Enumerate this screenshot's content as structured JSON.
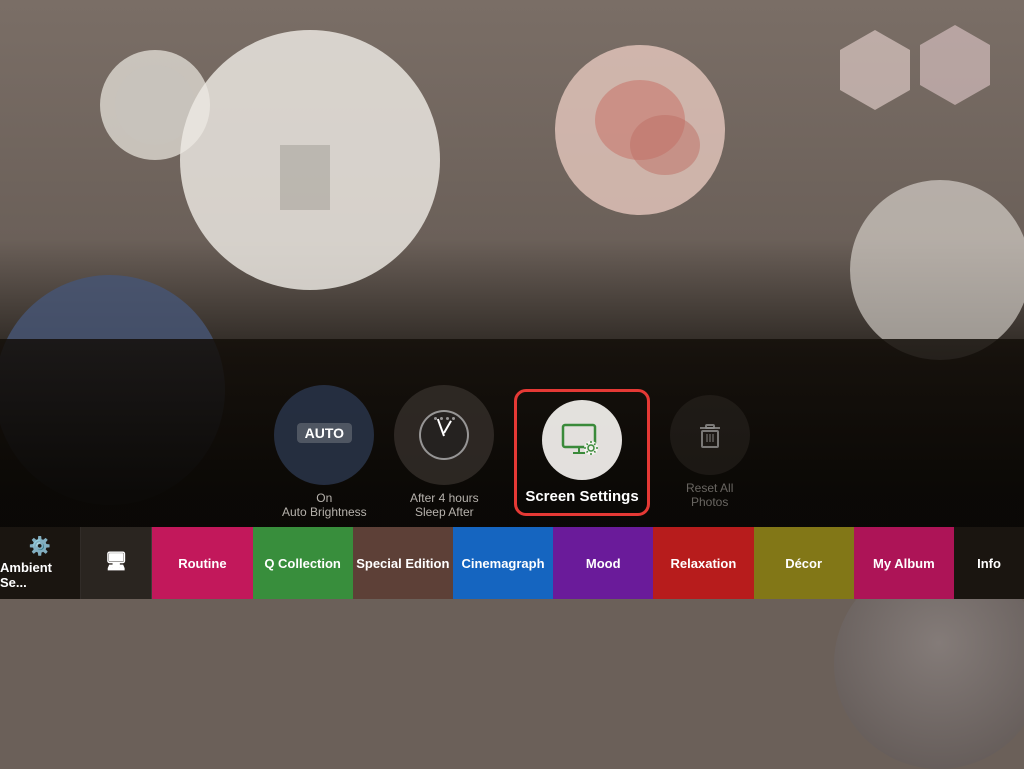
{
  "background": {
    "color": "#7a6e66"
  },
  "controls": {
    "auto_brightness": {
      "auto_label": "AUTO",
      "status": "On",
      "sub": "Auto Brightness"
    },
    "sleep": {
      "status": "After 4 hours",
      "sub": "Sleep After"
    },
    "screen_settings": {
      "label": "Screen Settings"
    },
    "reset": {
      "label": "Reset All Photos"
    }
  },
  "tabs": [
    {
      "id": "ambient",
      "label": "Ambient Se...",
      "icon": "⚙",
      "color": "#1a1510"
    },
    {
      "id": "screen",
      "label": "",
      "icon": "🖥",
      "color": "#2a2520"
    },
    {
      "id": "routine",
      "label": "Routine",
      "color": "#c2185b"
    },
    {
      "id": "collection",
      "label": "Q Collection",
      "color": "#388e3c"
    },
    {
      "id": "special",
      "label": "Special Edition",
      "color": "#5d4037"
    },
    {
      "id": "cinemagraph",
      "label": "Cinemagraph",
      "color": "#1565c0"
    },
    {
      "id": "mood",
      "label": "Mood",
      "color": "#6a1b9a"
    },
    {
      "id": "relaxation",
      "label": "Relaxation",
      "color": "#b71c1c"
    },
    {
      "id": "decor",
      "label": "Décor",
      "color": "#827717"
    },
    {
      "id": "myalbum",
      "label": "My Album",
      "color": "#ad1457"
    },
    {
      "id": "info",
      "label": "Info",
      "color": "#1a1510"
    }
  ]
}
